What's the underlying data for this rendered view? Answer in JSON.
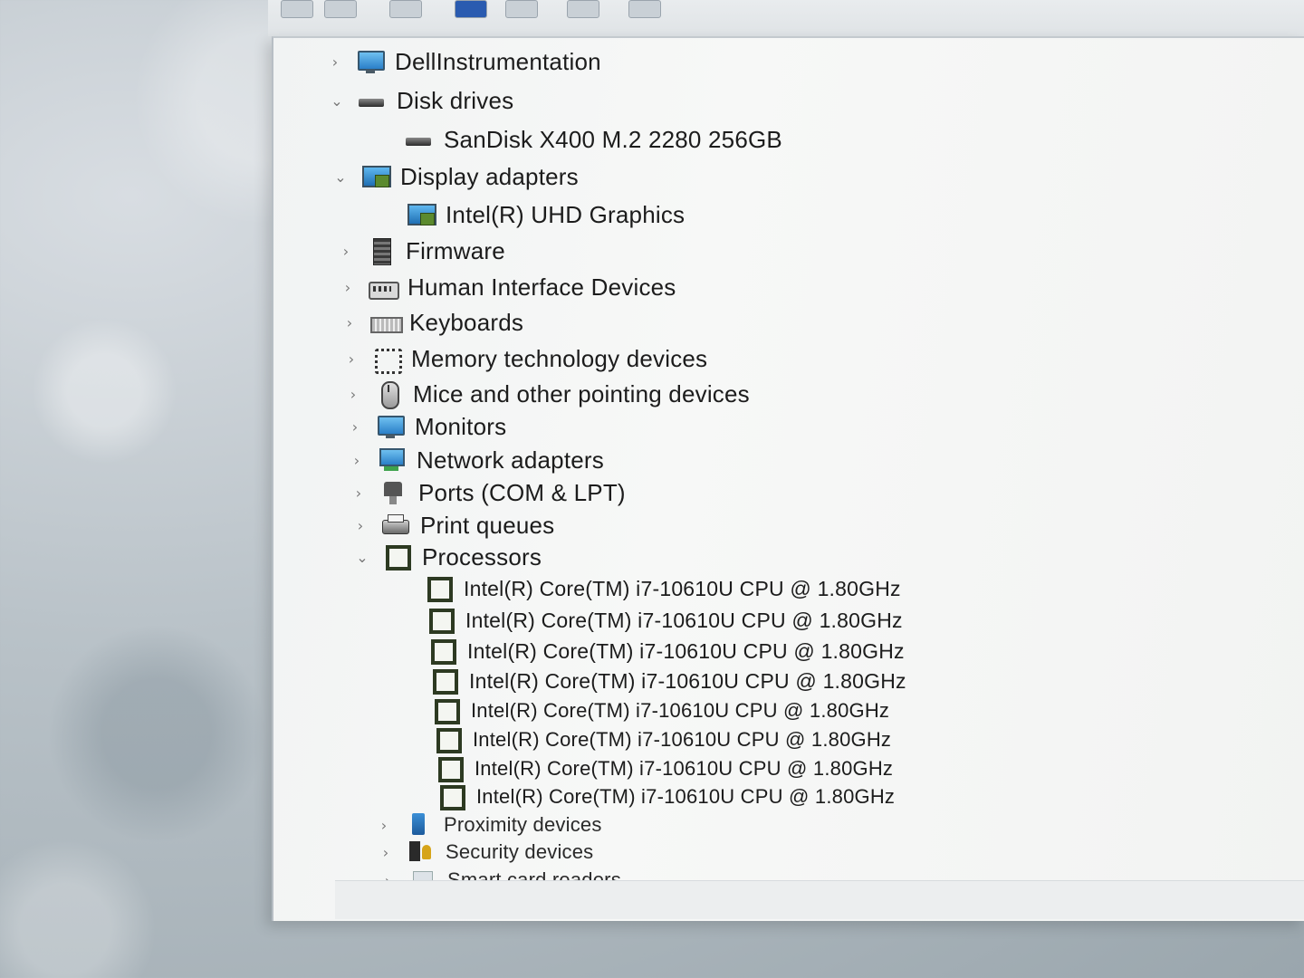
{
  "tree": {
    "items": [
      {
        "chevron": "›",
        "icon": "monitor-icon",
        "label": "DellInstrumentation"
      },
      {
        "chevron": "⌄",
        "icon": "disk-drive-icon",
        "label": "Disk drives"
      },
      {
        "chevron": "",
        "icon": "disk-drive-icon",
        "label": "SanDisk X400 M.2 2280 256GB"
      },
      {
        "chevron": "⌄",
        "icon": "display-adapter-icon",
        "label": "Display adapters"
      },
      {
        "chevron": "",
        "icon": "display-adapter-icon",
        "label": "Intel(R) UHD Graphics"
      },
      {
        "chevron": "›",
        "icon": "firmware-icon",
        "label": "Firmware"
      },
      {
        "chevron": "›",
        "icon": "hid-icon",
        "label": "Human Interface Devices"
      },
      {
        "chevron": "›",
        "icon": "keyboard-icon",
        "label": "Keyboards"
      },
      {
        "chevron": "›",
        "icon": "memory-icon",
        "label": "Memory technology devices"
      },
      {
        "chevron": "›",
        "icon": "mouse-icon",
        "label": "Mice and other pointing devices"
      },
      {
        "chevron": "›",
        "icon": "monitor-icon",
        "label": "Monitors"
      },
      {
        "chevron": "›",
        "icon": "network-adapter-icon",
        "label": "Network adapters"
      },
      {
        "chevron": "›",
        "icon": "port-icon",
        "label": "Ports (COM & LPT)"
      },
      {
        "chevron": "›",
        "icon": "printer-icon",
        "label": "Print queues"
      },
      {
        "chevron": "⌄",
        "icon": "processor-icon",
        "label": "Processors"
      },
      {
        "chevron": "",
        "icon": "processor-icon",
        "label": "Intel(R) Core(TM) i7-10610U CPU @ 1.80GHz"
      },
      {
        "chevron": "",
        "icon": "processor-icon",
        "label": "Intel(R) Core(TM) i7-10610U CPU @ 1.80GHz"
      },
      {
        "chevron": "",
        "icon": "processor-icon",
        "label": "Intel(R) Core(TM) i7-10610U CPU @ 1.80GHz"
      },
      {
        "chevron": "",
        "icon": "processor-icon",
        "label": "Intel(R) Core(TM) i7-10610U CPU @ 1.80GHz"
      },
      {
        "chevron": "",
        "icon": "processor-icon",
        "label": "Intel(R) Core(TM) i7-10610U CPU @ 1.80GHz"
      },
      {
        "chevron": "",
        "icon": "processor-icon",
        "label": "Intel(R) Core(TM) i7-10610U CPU @ 1.80GHz"
      },
      {
        "chevron": "",
        "icon": "processor-icon",
        "label": "Intel(R) Core(TM) i7-10610U CPU @ 1.80GHz"
      },
      {
        "chevron": "",
        "icon": "processor-icon",
        "label": "Intel(R) Core(TM) i7-10610U CPU @ 1.80GHz"
      },
      {
        "chevron": "›",
        "icon": "proximity-icon",
        "label": "Proximity devices"
      },
      {
        "chevron": "›",
        "icon": "security-icon",
        "label": "Security devices"
      },
      {
        "chevron": "›",
        "icon": "smart-card-icon",
        "label": "Smart card readers"
      }
    ]
  }
}
